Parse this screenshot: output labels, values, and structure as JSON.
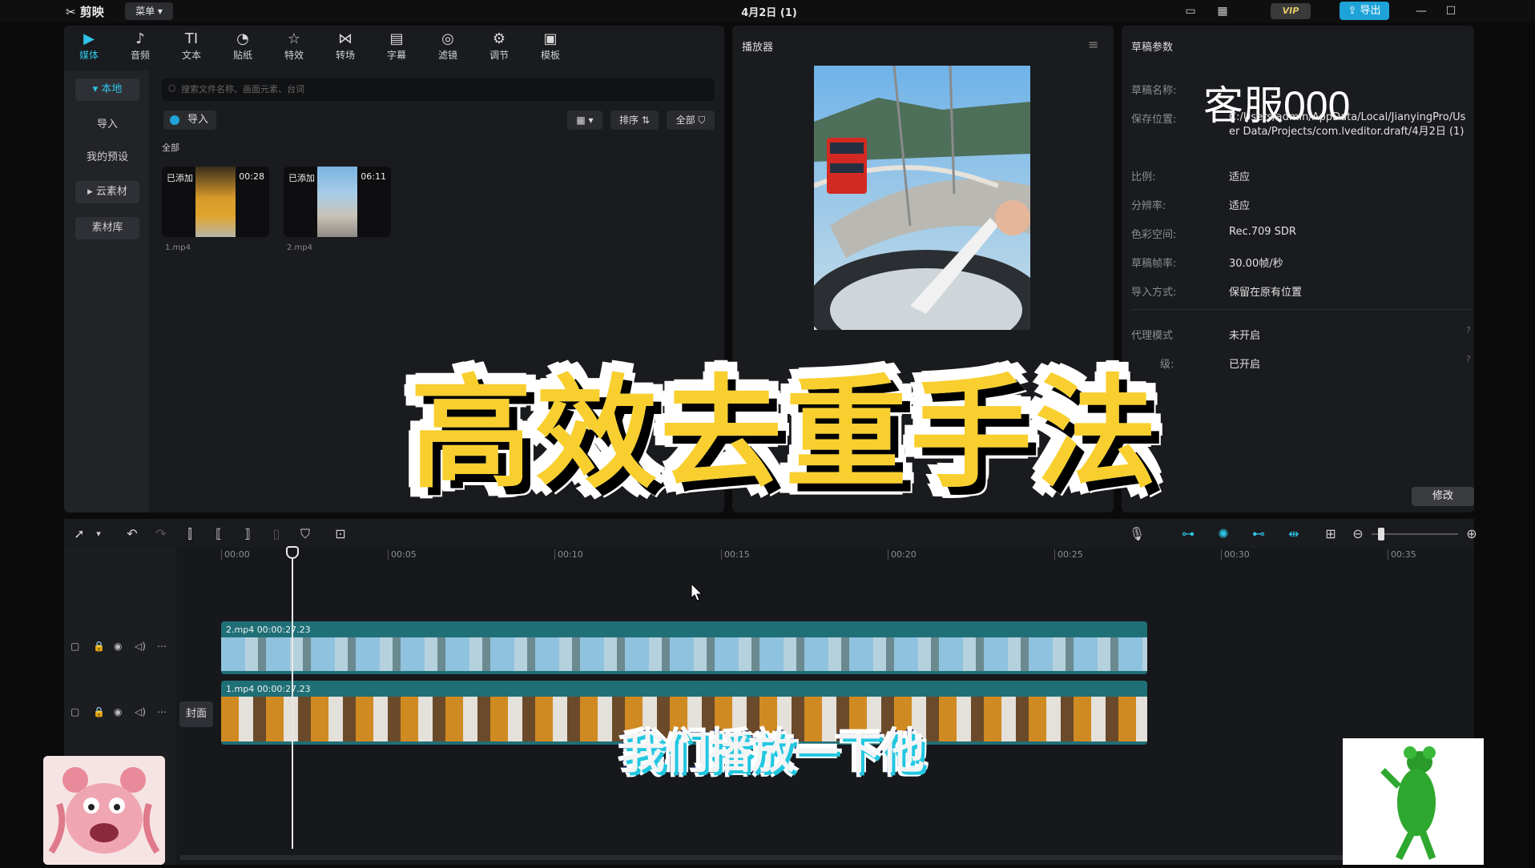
{
  "app": {
    "logo_text": "剪映",
    "menu_label": "菜单",
    "window_title": "4月2日 (1)",
    "vip_label": "VIP",
    "export_label": "导出"
  },
  "media": {
    "tabs": [
      {
        "label": "媒体",
        "icon": "media-icon",
        "glyph": "▶"
      },
      {
        "label": "音频",
        "icon": "audio-icon",
        "glyph": "♪"
      },
      {
        "label": "文本",
        "icon": "text-icon",
        "glyph": "TI"
      },
      {
        "label": "贴纸",
        "icon": "sticker-icon",
        "glyph": "◔"
      },
      {
        "label": "特效",
        "icon": "effects-icon",
        "glyph": "☆"
      },
      {
        "label": "转场",
        "icon": "transition-icon",
        "glyph": "⋈"
      },
      {
        "label": "字幕",
        "icon": "subtitle-icon",
        "glyph": "▤"
      },
      {
        "label": "滤镜",
        "icon": "filter-icon",
        "glyph": "◎"
      },
      {
        "label": "调节",
        "icon": "adjust-icon",
        "glyph": "⚙"
      },
      {
        "label": "模板",
        "icon": "template-icon",
        "glyph": "▣"
      }
    ],
    "side": {
      "local": "本地",
      "import": "导入",
      "my_presets": "我的预设",
      "cloud": "云素材",
      "library": "素材库"
    },
    "search_placeholder": "搜索文件名称、画面元素、台词",
    "import_label": "导入",
    "sort_label": "排序",
    "all_filter_label": "全部",
    "all_label": "全部",
    "clips": [
      {
        "added": "已添加",
        "duration": "00:28",
        "name": "1.mp4"
      },
      {
        "added": "已添加",
        "duration": "06:11",
        "name": "2.mp4"
      }
    ]
  },
  "player": {
    "title": "播放器"
  },
  "draft": {
    "title": "草稿参数",
    "overlay_text": "客服000",
    "name_label": "草稿名称:",
    "save_label": "保存位置:",
    "save_path": "C:/Users/admin/AppData/Local/JianyingPro/User Data/Projects/com.lveditor.draft/4月2日 (1)",
    "ratio_label": "比例:",
    "ratio_value": "适应",
    "resolution_label": "分辨率:",
    "resolution_value": "适应",
    "colorspace_label": "色彩空间:",
    "colorspace_value": "Rec.709 SDR",
    "fps_label": "草稿帧率:",
    "fps_value": "30.00帧/秒",
    "import_mode_label": "导入方式:",
    "import_mode_value": "保留在原有位置",
    "proxy_label": "代理模式",
    "proxy_value": "未开启",
    "level_label": "级:",
    "level_value": "已开启",
    "modify_label": "修改"
  },
  "timeline": {
    "ruler": [
      "00:00",
      "00:05",
      "00:10",
      "00:15",
      "00:20",
      "00:25",
      "00:30",
      "00:35"
    ],
    "tracks": [
      {
        "label": "2.mp4  00:00:27.23"
      },
      {
        "label": "1.mp4  00:00:27.23"
      }
    ],
    "cover_label": "封面"
  },
  "overlay": {
    "big_title": "高效去重手法",
    "subtitle": "我们播放一下他"
  },
  "colors": {
    "accent": "#1ea3d8",
    "title_yellow": "#f8cf2e",
    "track_teal": "#1f6f76"
  }
}
